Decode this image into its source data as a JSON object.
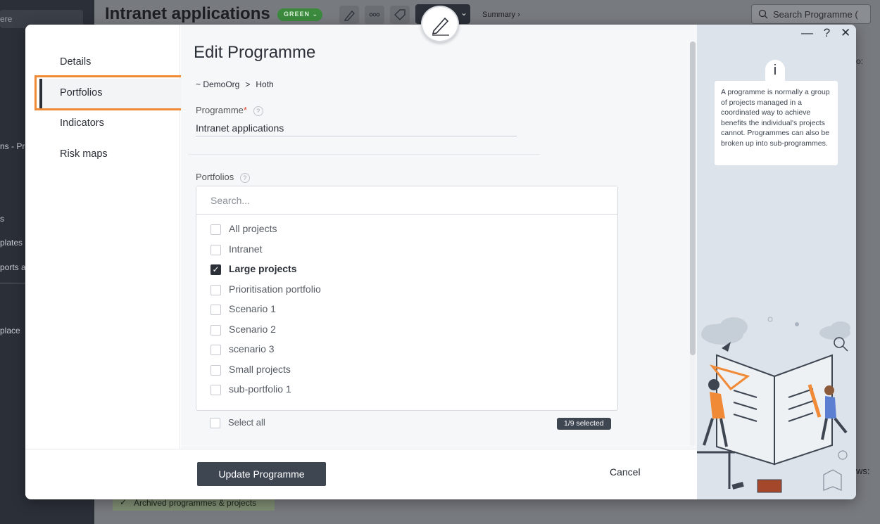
{
  "background": {
    "app_title": "Intranet applications",
    "status_badge": "GREEN",
    "summary_link": "Summary ›",
    "search_placeholder": "Search Programme (",
    "top_search_fragment": "ere",
    "sidebar_fragments": [
      "ns - Pro",
      "s",
      "plates",
      "ports a",
      "place"
    ],
    "archived_label": "Archived programmes & projects",
    "ws_fragment": "ws:",
    "col_fragment": "o:"
  },
  "modal": {
    "nav": {
      "items": [
        "Details",
        "Portfolios",
        "Indicators",
        "Risk maps"
      ],
      "active": "Portfolios"
    },
    "title": "Edit Programme",
    "breadcrumb": {
      "root": "~ DemoOrg",
      "separator": ">",
      "current": "Hoth"
    },
    "programme_field": {
      "label": "Programme",
      "required_marker": "*",
      "value": "Intranet applications"
    },
    "portfolios_field": {
      "label": "Portfolios",
      "search_placeholder": "Search...",
      "options": [
        {
          "label": "All projects",
          "checked": false
        },
        {
          "label": "Intranet",
          "checked": false
        },
        {
          "label": "Large projects",
          "checked": true
        },
        {
          "label": "Prioritisation portfolio",
          "checked": false
        },
        {
          "label": "Scenario 1",
          "checked": false
        },
        {
          "label": "Scenario 2",
          "checked": false
        },
        {
          "label": "scenario 3",
          "checked": false
        },
        {
          "label": "Small projects",
          "checked": false
        },
        {
          "label": "sub-portfolio 1",
          "checked": false
        }
      ],
      "select_all_label": "Select all",
      "selected_count": "1/9 selected"
    },
    "footer": {
      "update_label": "Update Programme",
      "cancel_label": "Cancel"
    },
    "window_controls": {
      "minimize": "—",
      "help": "?",
      "close": "✕"
    },
    "info": {
      "icon_letter": "i",
      "text": "A programme is normally a group of projects managed in a coordinated way to achieve benefits the individual's projects cannot. Programmes can also be broken up into sub-programmes."
    }
  },
  "colors": {
    "accent_dark": "#3e4652",
    "highlight_orange": "#f08a36",
    "required_red": "#e0452f",
    "info_panel_bg": "#dde3ea",
    "status_green": "#3b8a3e"
  }
}
